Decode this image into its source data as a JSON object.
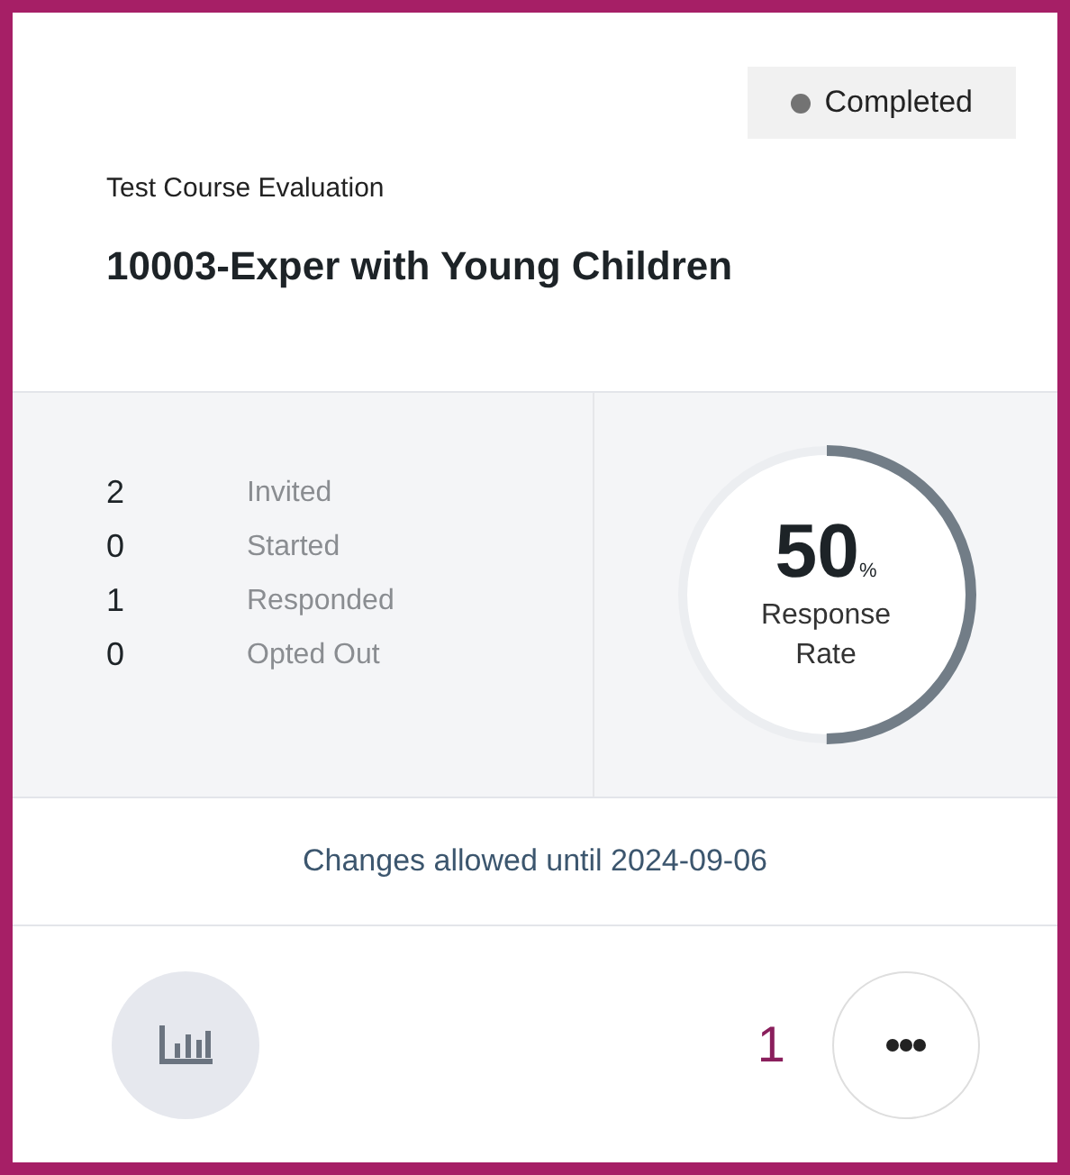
{
  "status": {
    "label": "Completed",
    "color": "#737373"
  },
  "category": "Test Course Evaluation",
  "title": "10003-Exper with Young Children",
  "stats": [
    {
      "value": "2",
      "label": "Invited"
    },
    {
      "value": "0",
      "label": "Started"
    },
    {
      "value": "1",
      "label": "Responded"
    },
    {
      "value": "0",
      "label": "Opted Out"
    }
  ],
  "response_rate": {
    "value": "50",
    "unit": "%",
    "label": "Response Rate",
    "level": 0.5
  },
  "changes_note": "Changes allowed until 2024-09-06",
  "footer": {
    "count": "1"
  }
}
